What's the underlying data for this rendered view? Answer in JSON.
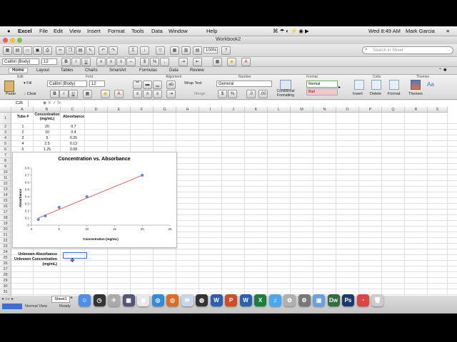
{
  "menubar": {
    "apple": "",
    "app": "Excel",
    "items": [
      "File",
      "Edit",
      "View",
      "Insert",
      "Format",
      "Tools",
      "Data",
      "Window",
      "Help"
    ],
    "clock": "Wed 8:49 AM",
    "user": "Mark Garcia"
  },
  "window": {
    "title": "Workbook2"
  },
  "toolbar": {
    "font": "Calibri (Body)",
    "size": "12",
    "zoom": "100%",
    "search_placeholder": "Search in Sheet"
  },
  "ribbon": {
    "tabs": [
      "Home",
      "Layout",
      "Tables",
      "Charts",
      "SmartArt",
      "Formulas",
      "Data",
      "Review"
    ],
    "groups": [
      "Edit",
      "Font",
      "Alignment",
      "Number",
      "Format",
      "Cells",
      "Themes"
    ],
    "paste": "Paste",
    "fill": "Fill",
    "clear": "Clear",
    "font": "Calibri (Body)",
    "size": "12",
    "wrap": "Wrap Text",
    "merge": "Merge",
    "number_format": "General",
    "cond_format": "Conditional Formatting",
    "style_normal": "Normal",
    "style_bad": "Bad",
    "insert": "Insert",
    "delete": "Delete",
    "format": "Format",
    "themes": "Themes"
  },
  "formula_bar": {
    "cell_ref": "C26",
    "value": ""
  },
  "columns": [
    "A",
    "B",
    "C",
    "D",
    "E",
    "F",
    "G",
    "H",
    "I",
    "J",
    "K",
    "L",
    "M",
    "N",
    "O",
    "P",
    "Q",
    "R",
    "S"
  ],
  "rows": [
    "1",
    "2",
    "3",
    "4",
    "5",
    "6",
    "7",
    "8",
    "9",
    "10",
    "11",
    "12",
    "13",
    "14",
    "15",
    "16",
    "17",
    "18",
    "19",
    "20",
    "21",
    "22",
    "23",
    "24",
    "25",
    "26",
    "27",
    "28",
    "29",
    "30",
    "31",
    "32"
  ],
  "table": {
    "headers": [
      "Tube #",
      "Concentration (mg/mL)",
      "Absorbance"
    ],
    "rows": [
      [
        "1",
        "20",
        "0.7"
      ],
      [
        "2",
        "10",
        "0.4"
      ],
      [
        "3",
        "5",
        "0.25"
      ],
      [
        "4",
        "2.5",
        "0.13"
      ],
      [
        "5",
        "1.25",
        "0.08"
      ]
    ]
  },
  "unknown": {
    "absorbance_label": "Unknown Absorbance",
    "concentration_label": "Unknown Concentration (mg/mL)"
  },
  "chart_data": {
    "type": "scatter",
    "title": "Concentration vs. Absorbance",
    "xlabel": "Concentration (mg/mL)",
    "ylabel": "Absorbance",
    "xlim": [
      0,
      25
    ],
    "ylim": [
      0,
      0.8
    ],
    "xticks": [
      "0",
      "5",
      "10",
      "15",
      "20",
      "25"
    ],
    "yticks": [
      "0",
      "0.1",
      "0.2",
      "0.3",
      "0.4",
      "0.5",
      "0.6",
      "0.7",
      "0.8"
    ],
    "x": [
      20,
      10,
      5,
      2.5,
      1.25
    ],
    "y": [
      0.7,
      0.4,
      0.25,
      0.13,
      0.08
    ],
    "trendline": {
      "x": [
        1.25,
        20
      ],
      "y": [
        0.1,
        0.7
      ]
    },
    "point_color": "#5b8dd9",
    "trendline_color": "#e0403a",
    "grid": false
  },
  "status": {
    "mode": "Normal View",
    "state": "Ready",
    "sheet_tab": "Sheet1"
  },
  "dock": [
    "Finder",
    "Dashboard",
    "Launchpad",
    "Mission Control",
    "Chrome",
    "Safari",
    "Firefox",
    "Mail",
    "Camera",
    "Word",
    "PowerPoint",
    "Word",
    "Excel",
    "iTunes",
    "iPhoto",
    "Automator",
    "Preview",
    "Dreamweaver",
    "Photoshop",
    "Photos",
    "Trash"
  ]
}
